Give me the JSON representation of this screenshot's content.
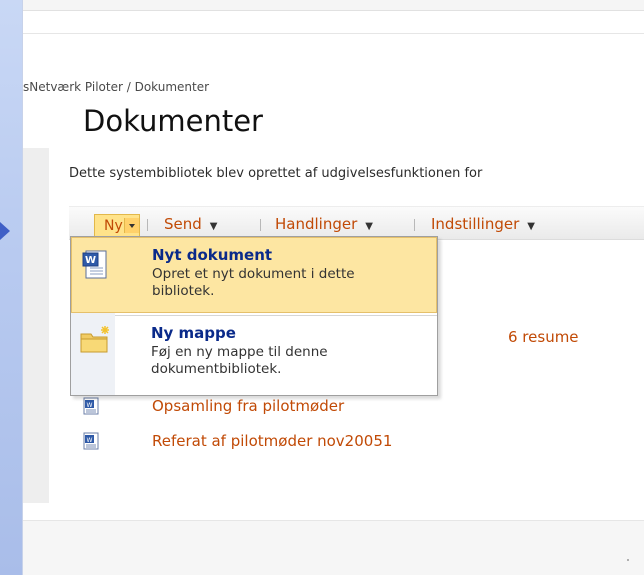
{
  "breadcrumb": {
    "path": "sNetværk Piloter / Dokumenter"
  },
  "page": {
    "title": "Dokumenter",
    "description": "Dette systembibliotek blev oprettet af udgivelsesfunktionen for"
  },
  "toolbar": {
    "ny": "Ny",
    "send": "Send",
    "handlinger": "Handlinger",
    "indstillinger": "Indstillinger"
  },
  "new_menu": {
    "items": [
      {
        "title": "Nyt dokument",
        "description": "Opret et nyt dokument i dette bibliotek.",
        "icon": "word-document-icon"
      },
      {
        "title": "Ny mappe",
        "description": "Føj en ny mappe til denne dokumentbibliotek.",
        "icon": "new-folder-icon"
      }
    ]
  },
  "documents": [
    {
      "name": "6 resume",
      "partial": true
    },
    {
      "name": "Opsamling fra pilotmøder"
    },
    {
      "name": "Referat af pilotmøder nov20051"
    }
  ],
  "colors": {
    "link": "#c14a06",
    "menu_title": "#0a2a8a",
    "highlight": "#fde6a2",
    "side_background": "#b9cbf0"
  }
}
